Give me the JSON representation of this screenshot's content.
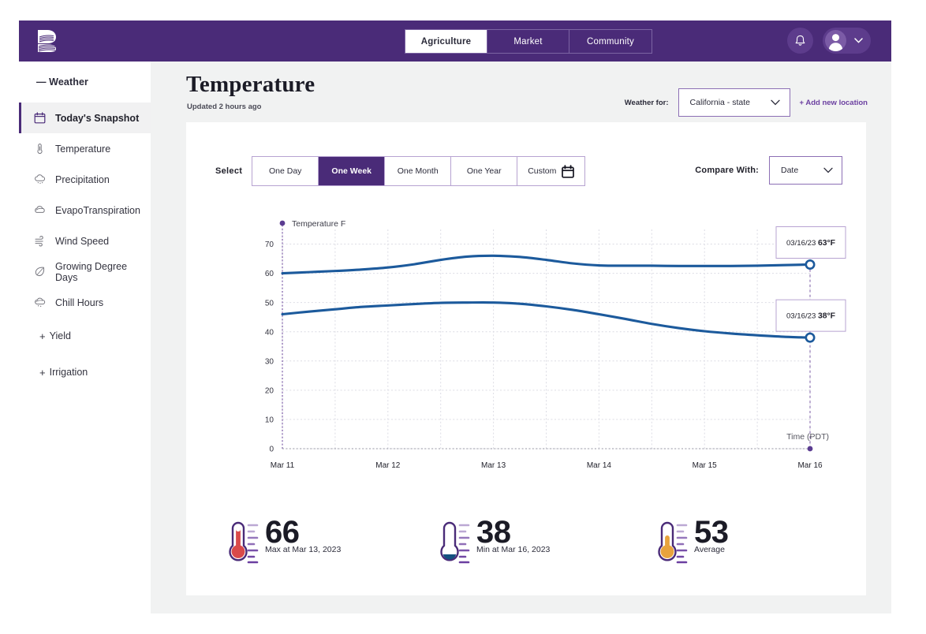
{
  "header": {
    "logo_icon": "brand-logo-icon",
    "tabs": [
      {
        "label": "Agriculture",
        "active": true
      },
      {
        "label": "Market",
        "active": false
      },
      {
        "label": "Community",
        "active": false
      }
    ],
    "bell_icon": "notification-bell-icon",
    "avatar_icon": "user-avatar-icon",
    "chevron_icon": "chevron-down-icon",
    "brand_color": "#4A2B78"
  },
  "sidebar": {
    "group_title": "— Weather",
    "items": [
      {
        "label": "Today's Snapshot",
        "icon": "calendar-icon",
        "active": true
      },
      {
        "label": "Temperature",
        "icon": "thermometer-icon",
        "active": false
      },
      {
        "label": "Precipitation",
        "icon": "rain-cloud-icon",
        "active": false
      },
      {
        "label": "EvapoTranspiration",
        "icon": "cloud-icon",
        "active": false
      },
      {
        "label": "Wind Speed",
        "icon": "wind-icon",
        "active": false
      },
      {
        "label": "Growing Degree Days",
        "icon": "leaf-icon",
        "active": false
      },
      {
        "label": "Chill Hours",
        "icon": "snow-cloud-icon",
        "active": false
      }
    ],
    "groups": [
      {
        "label": "Yield",
        "prefix": "+"
      },
      {
        "label": "Irrigation",
        "prefix": "+"
      }
    ]
  },
  "main": {
    "title": "Temperature",
    "subtitle": "Updated 2 hours ago",
    "weather_for_label": "Weather for:",
    "location_value": "California - state",
    "add_location_label": "+ Add new location",
    "select_label": "Select",
    "ranges": [
      {
        "label": "One Day",
        "active": false
      },
      {
        "label": "One Week",
        "active": true
      },
      {
        "label": "One Month",
        "active": false
      },
      {
        "label": "One Year",
        "active": false
      },
      {
        "label": "Custom",
        "active": false,
        "icon": "calendar-icon"
      }
    ],
    "compare_label": "Compare With:",
    "compare_value": "Date"
  },
  "chart_data": {
    "type": "line",
    "title": "",
    "ylabel": "Temperature F",
    "xlabel": "Time (PDT)",
    "legend": [
      "Temperature F"
    ],
    "legend_position": "top-left",
    "grid": true,
    "ylim": [
      0,
      75
    ],
    "yticks": [
      0,
      10,
      20,
      30,
      40,
      50,
      60,
      70
    ],
    "categories": [
      "Mar 11",
      "Mar 12",
      "Mar 13",
      "Mar 14",
      "Mar 15",
      "Mar 16"
    ],
    "x": [
      0,
      1,
      2,
      3,
      4,
      5
    ],
    "series": [
      {
        "name": "Max Temperature F",
        "color": "#1C5A9C",
        "values": [
          60,
          62,
          66,
          63,
          62.5,
          63
        ],
        "dense_x": [
          0,
          0.25,
          0.5,
          0.75,
          1,
          1.25,
          1.5,
          1.75,
          2,
          2.25,
          2.5,
          2.75,
          3,
          3.25,
          3.5,
          3.75,
          4,
          4.25,
          4.5,
          4.75,
          5
        ],
        "dense_values": [
          60,
          60.4,
          60.8,
          61.3,
          62,
          63.1,
          64.6,
          65.7,
          66,
          65.6,
          64.6,
          63.4,
          62.7,
          62.6,
          62.6,
          62.5,
          62.5,
          62.5,
          62.6,
          62.8,
          63
        ]
      },
      {
        "name": "Min Temperature F",
        "color": "#1C5A9C",
        "values": [
          46,
          49,
          50,
          47,
          41,
          38
        ],
        "dense_x": [
          0,
          0.25,
          0.5,
          0.75,
          1,
          1.25,
          1.5,
          1.75,
          2,
          2.25,
          2.5,
          2.75,
          3,
          3.25,
          3.5,
          3.75,
          4,
          4.25,
          4.5,
          4.75,
          5
        ],
        "dense_values": [
          46,
          46.9,
          47.7,
          48.5,
          49,
          49.5,
          49.9,
          50,
          50,
          49.6,
          48.7,
          47.5,
          46,
          44.4,
          42.7,
          41.3,
          40.2,
          39.4,
          38.8,
          38.3,
          38
        ]
      }
    ],
    "annotations": [
      {
        "label_date": "03/16/23",
        "label_value": "63°F",
        "series": "Max Temperature F",
        "x": 5,
        "y": 63
      },
      {
        "label_date": "03/16/23",
        "label_value": "38°F",
        "series": "Min Temperature F",
        "x": 5,
        "y": 38
      }
    ]
  },
  "stats": [
    {
      "value": "66",
      "caption": "Max at Mar 13, 2023",
      "icon": "thermometer-hot-icon",
      "color": "#D94A4A"
    },
    {
      "value": "38",
      "caption": "Min at Mar 16, 2023",
      "icon": "thermometer-cold-icon",
      "color": "#1C5A9C"
    },
    {
      "value": "53",
      "caption": "Average",
      "icon": "thermometer-average-icon",
      "color": "#E8A33D"
    }
  ]
}
